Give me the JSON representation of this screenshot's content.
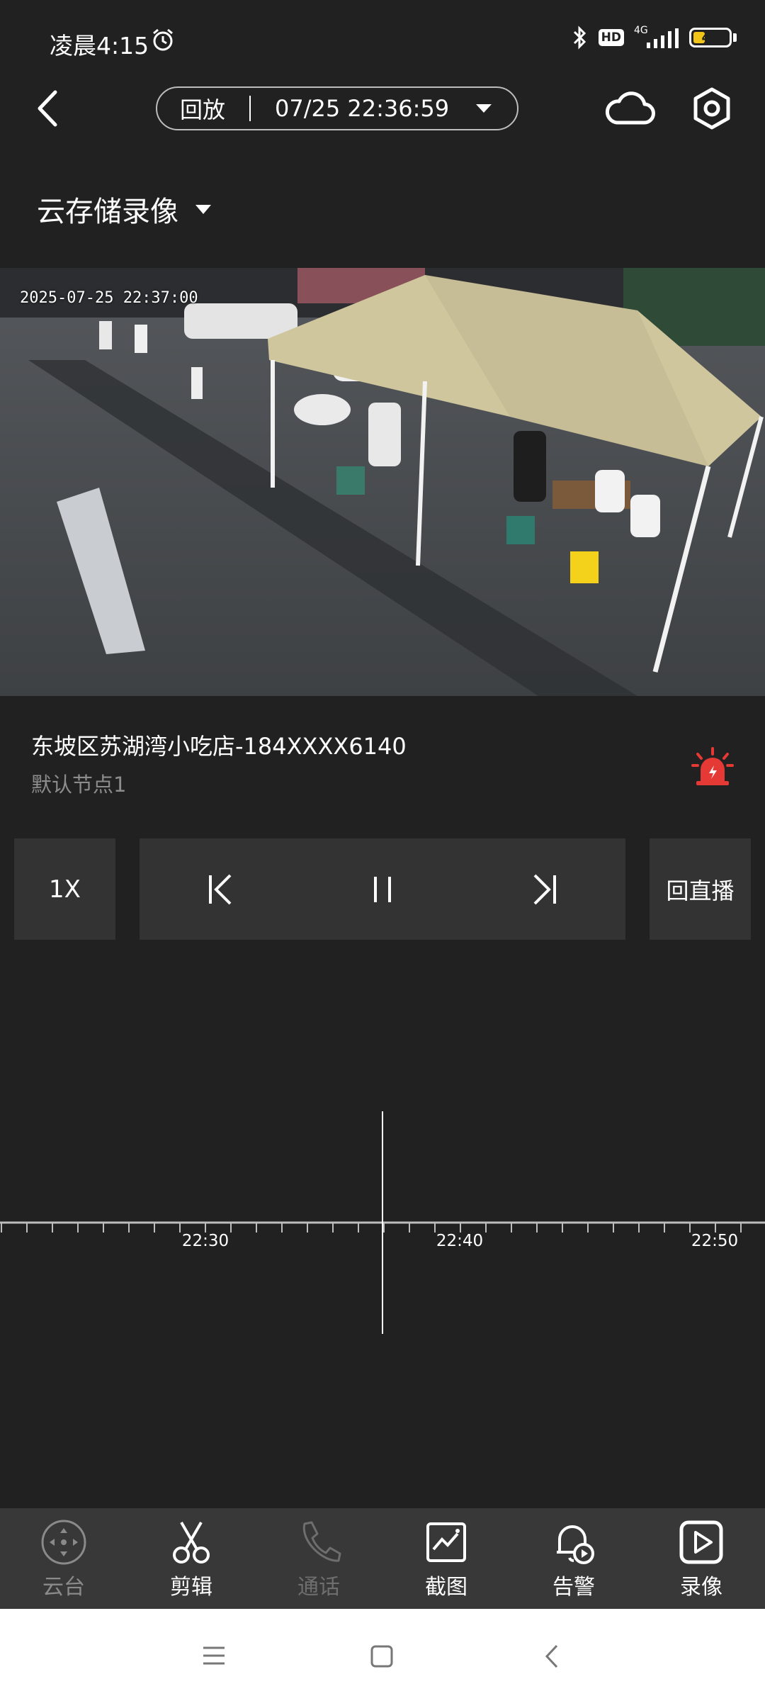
{
  "status_bar": {
    "time": "凌晨4:15",
    "hd_badge": "HD",
    "network": "4G",
    "battery": "40",
    "battery_level": 0.4
  },
  "header": {
    "mode": "回放",
    "datetime": "07/25 22:36:59"
  },
  "storage": {
    "label": "云存储录像"
  },
  "video": {
    "timestamp": "2025-07-25 22:37:00"
  },
  "device": {
    "name": "东坡区苏湖湾小吃店-184XXXX6140",
    "node": "默认节点1"
  },
  "controls": {
    "speed": "1X",
    "live": "回直播"
  },
  "timeline": {
    "labels": [
      "22:30",
      "22:40",
      "22:50"
    ]
  },
  "tabs": [
    {
      "label": "云台",
      "icon": "ptz-icon",
      "color": "#8a8a8a"
    },
    {
      "label": "剪辑",
      "icon": "scissors-icon",
      "color": "#ffffff"
    },
    {
      "label": "通话",
      "icon": "phone-icon",
      "color": "#6e6e6e"
    },
    {
      "label": "截图",
      "icon": "screenshot-icon",
      "color": "#ffffff"
    },
    {
      "label": "告警",
      "icon": "alert-bell-icon",
      "color": "#ffffff"
    },
    {
      "label": "录像",
      "icon": "video-record-icon",
      "color": "#ffffff"
    }
  ],
  "colors": {
    "background": "#212121",
    "control_bg": "#333333",
    "tabbar_bg": "#383838",
    "alarm_red": "#e53935",
    "timeline_line": "#bdbdbd"
  }
}
